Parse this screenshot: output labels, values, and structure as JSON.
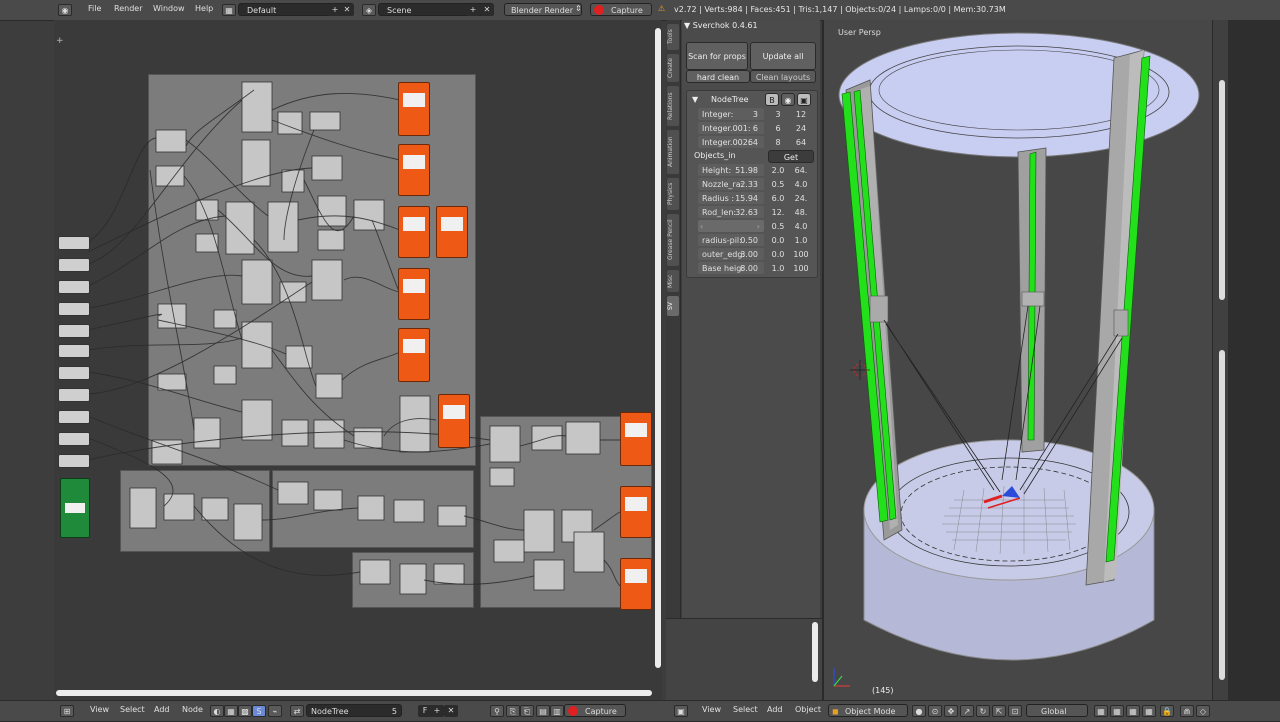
{
  "top_menu": [
    "File",
    "Render",
    "Window",
    "Help"
  ],
  "layout_name": "Default",
  "scene_name": "Scene",
  "render_engine": "Blender Render",
  "capture_label": "Capture",
  "stats": "v2.72 | Verts:984 | Faces:451 | Tris:1,147 | Objects:0/24 | Lamps:0/0 | Mem:30.73M",
  "shelf_tabs": [
    "Tools",
    "Create",
    "Relations",
    "Animation",
    "Physics",
    "Grease Pencil",
    "Misc",
    "SV"
  ],
  "sverchok": {
    "header": "Sverchok 0.4.61",
    "scan_props": "Scan for props",
    "update_all": "Update all",
    "hard_clean": "hard clean",
    "clean_layouts": "Clean layouts",
    "nodetree_label": "NodeTree",
    "bake_label": "B",
    "eye_icon": "eye-icon",
    "integers": [
      {
        "label": "Integer:",
        "value": "3",
        "min": "3",
        "max": "12"
      },
      {
        "label": "Integer.001:",
        "value": "6",
        "min": "6",
        "max": "24"
      },
      {
        "label": "Integer.002:",
        "value": "64",
        "min": "8",
        "max": "64"
      }
    ],
    "objects_in": "Objects_in",
    "get_label": "Get",
    "floats": [
      {
        "label": "Height:",
        "value": "51.98",
        "min": "2.0",
        "max": "64."
      },
      {
        "label": "Nozzle_ra:",
        "value": "2.33",
        "min": "0.5",
        "max": "4.0"
      },
      {
        "label": "Radius :",
        "value": "15.94",
        "min": "6.0",
        "max": "24."
      },
      {
        "label": "Rod_len:",
        "value": "32.63",
        "min": "12.",
        "max": "48."
      },
      {
        "label": "",
        "value": "",
        "min": "0.5",
        "max": "4.0"
      },
      {
        "label": "radius-pil:",
        "value": "0.50",
        "min": "0.0",
        "max": "1.0"
      },
      {
        "label": "outer_edg:",
        "value": "3.00",
        "min": "0.0",
        "max": "100"
      },
      {
        "label": "Base heig:",
        "value": "8.00",
        "min": "1.0",
        "max": "100"
      }
    ]
  },
  "viewport": {
    "view_label": "User Persp",
    "frame_label": "(145)"
  },
  "bottom_bar": {
    "node_menus": [
      "View",
      "Select",
      "Add",
      "Node"
    ],
    "nodetree_field": "NodeTree",
    "nodetree_users": "5",
    "capture_label": "Capture",
    "view3d_menus": [
      "View",
      "Select",
      "Add",
      "Object"
    ],
    "mode": "Object Mode",
    "orientation": "Global"
  },
  "colors": {
    "orange_node": "#ee5a15",
    "green_node": "#1f8a3a",
    "rod_green": "#22e01a",
    "bed": "#c8cbe8",
    "top_plate": "#c8cdf2"
  }
}
